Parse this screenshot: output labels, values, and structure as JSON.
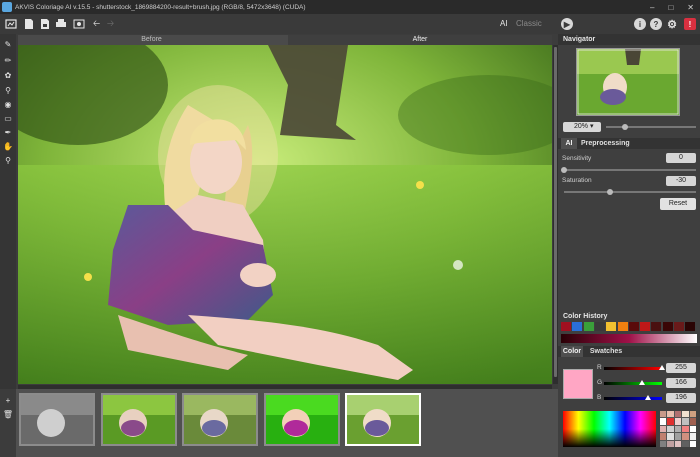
{
  "window": {
    "title": "AKVIS Coloriage AI v.15.5 - shutterstock_1869884200-result+brush.jpg (RGB/8, 5472x3648) (CUDA)"
  },
  "toolbar": {
    "mode_ai": "AI",
    "mode_classic": "Classic"
  },
  "view_tabs": {
    "before": "Before",
    "after": "After"
  },
  "navigator": {
    "title": "Navigator",
    "zoom": "20%"
  },
  "settings_tabs": {
    "ai": "AI",
    "preprocessing": "Preprocessing"
  },
  "params": {
    "sensitivity": {
      "label": "Sensitivity",
      "value": "0",
      "level": 0.0
    },
    "saturation": {
      "label": "Saturation",
      "value": "-30",
      "level": 0.35
    },
    "reset": "Reset"
  },
  "color_history": {
    "title": "Color History",
    "swatches": [
      "#a01020",
      "#2a6fd8",
      "#3aa03a",
      "#3a3a3a",
      "#f2c030",
      "#f08010",
      "#5a0a0a",
      "#c01818",
      "#4a1010",
      "#3a0606",
      "#6a1a1a",
      "#2a0404"
    ]
  },
  "color_panel": {
    "tab_color": "Color",
    "tab_swatches": "Swatches",
    "r": {
      "label": "R",
      "value": "255"
    },
    "g": {
      "label": "G",
      "value": "166"
    },
    "b": {
      "label": "B",
      "value": "196"
    },
    "current": "#ffa6c4"
  },
  "palette": [
    "#c89a8a",
    "#e8c0b0",
    "#b07070",
    "#f0e0d0",
    "#d0a080",
    "#ffffff",
    "#e03030",
    "#f0d0d0",
    "#c0c0c0",
    "#a06050",
    "#e0b0b0",
    "#d0d0d0",
    "#b0b0b0",
    "#f08080",
    "#ffffff",
    "#c08070",
    "#e0e0e0",
    "#a0a0a0",
    "#d09080",
    "#f0f0f0",
    "#808080",
    "#c0a0a0",
    "#e0c0c0",
    "#606060",
    "#ffffff"
  ],
  "thumbnails": [
    "bw",
    "color1",
    "color2",
    "vivid",
    "selected"
  ]
}
